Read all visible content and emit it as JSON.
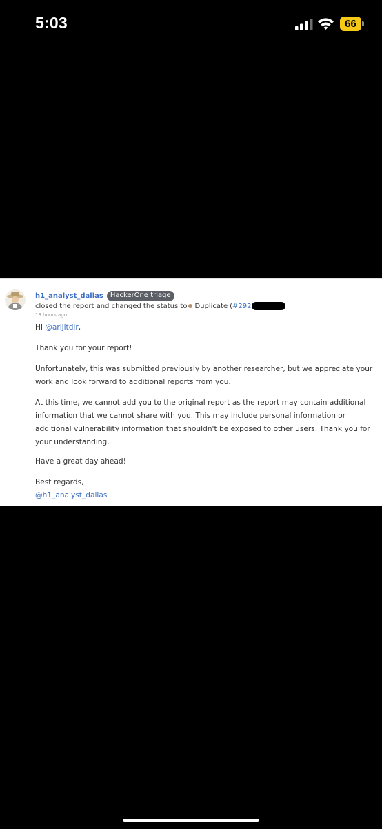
{
  "status_bar": {
    "time": "5:03",
    "battery_level": "66",
    "icons": [
      "signal-icon",
      "wifi-icon",
      "battery-icon"
    ],
    "battery_color": "#f5c916"
  },
  "comment": {
    "author": "h1_analyst_dallas",
    "role_badge": "HackerOne triage",
    "action_text": "closed the report and changed the status to",
    "status_label": "Duplicate",
    "paren_open": "(",
    "report_ref_prefix": "#292",
    "timestamp": "13 hours ago",
    "greeting_prefix": "Hi ",
    "greeting_mention": "@arijitdir",
    "greeting_suffix": ",",
    "para_thanks": "Thank you for your report!",
    "para_unfortunately": "Unfortunately, this was submitted previously by another researcher, but we appreciate your work and look forward to additional reports from you.",
    "para_at_this_time": "At this time, we cannot add you to the original report as the report may contain additional information that we cannot share with you. This may include personal information or additional vulnerability information that shouldn't be exposed to other users. Thank you for your understanding.",
    "para_have_day": "Have a great day ahead!",
    "sign_off": "Best regards,",
    "signature_mention": "@h1_analyst_dallas"
  },
  "colors": {
    "link": "#3d6fc2",
    "badge_bg": "#5d5f66",
    "duplicate_dot": "#b09070",
    "background": "#000000",
    "panel": "#ffffff"
  }
}
